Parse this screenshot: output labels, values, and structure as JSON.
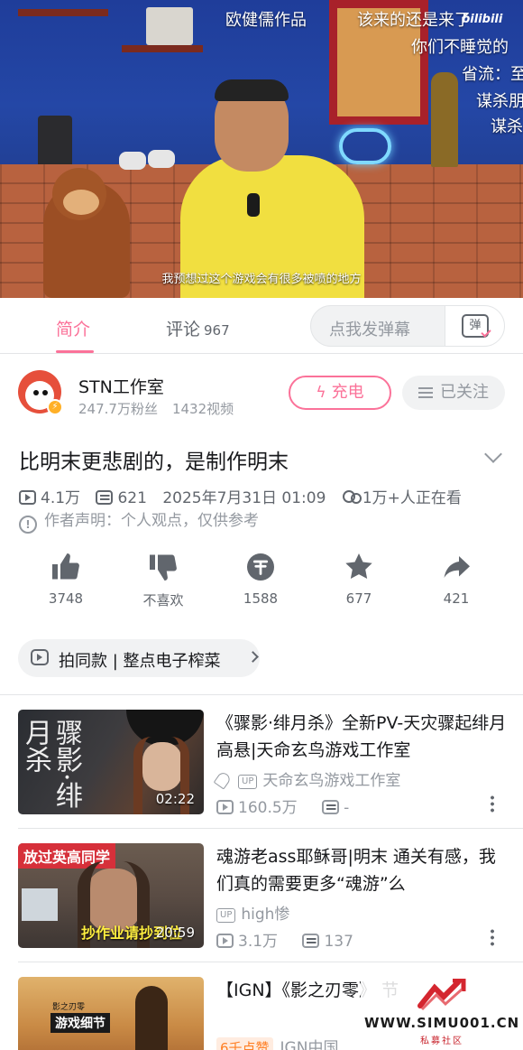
{
  "video": {
    "overlay_author": "欧健儒作品",
    "danmaku_lines": [
      "该来的还是来了",
      "你们不睡觉的",
      "省流：至",
      "谋杀朋",
      "谋杀"
    ],
    "subtitle": "我预想过这个游戏会有很多被喷的地方",
    "logo": "bilibili"
  },
  "tabs": {
    "intro": "简介",
    "comments": "评论",
    "comments_count": "967",
    "danmaku_placeholder": "点我发弹幕",
    "danmaku_icon_text": "弹"
  },
  "uploader": {
    "name": "STN工作室",
    "fans": "247.7万粉丝",
    "videos": "1432视频",
    "charge_label": "充电",
    "follow_label": "已关注"
  },
  "video_info": {
    "title": "比明末更悲剧的，是制作明末",
    "views": "4.1万",
    "danmaku_count": "621",
    "publish_time": "2025年7月31日 01:09",
    "watching": "1万+人正在看",
    "statement": "作者声明：个人观点，仅供参考"
  },
  "actions": [
    {
      "icon": "like-icon",
      "count": "3748"
    },
    {
      "icon": "dislike-icon",
      "count": "不喜欢"
    },
    {
      "icon": "coin-icon",
      "count": "1588"
    },
    {
      "icon": "favorite-icon",
      "count": "677"
    },
    {
      "icon": "share-icon",
      "count": "421"
    }
  ],
  "same_style": {
    "label": "拍同款 | 整点电子榨菜"
  },
  "recommendations": [
    {
      "title": "《骤影·绯月杀》全新PV-天灾骤起绯月高悬|天命玄鸟游戏工作室",
      "up_tag": "UP",
      "author": "天命玄鸟游戏工作室",
      "views": "160.5万",
      "danmaku": "-",
      "duration": "02:22",
      "thumb_text": "骤影·绯月杀"
    },
    {
      "title": "魂游老ass耶稣哥|明末 通关有感，我们真的需要更多“魂游”么",
      "up_tag": "UP",
      "author": "high惨",
      "views": "3.1万",
      "danmaku": "137",
      "duration": "20:59",
      "thumb_top": "放过英高同学",
      "thumb_bottom": "抄作业请抄到位"
    },
    {
      "title": "【IGN】《影之刃零》 节",
      "hot": "6千点赞",
      "author": "IGN中国",
      "thumb_text": "游戏细节",
      "thumb_small": "影之刃零"
    }
  ],
  "watermark": {
    "text": "WWW.SIMU001.CN",
    "sub": "私募社区"
  },
  "colors": {
    "accent": "#fb7299",
    "text_primary": "#18191c",
    "text_secondary": "#61666d",
    "text_tertiary": "#9499a0",
    "divider": "#e3e5e7"
  }
}
